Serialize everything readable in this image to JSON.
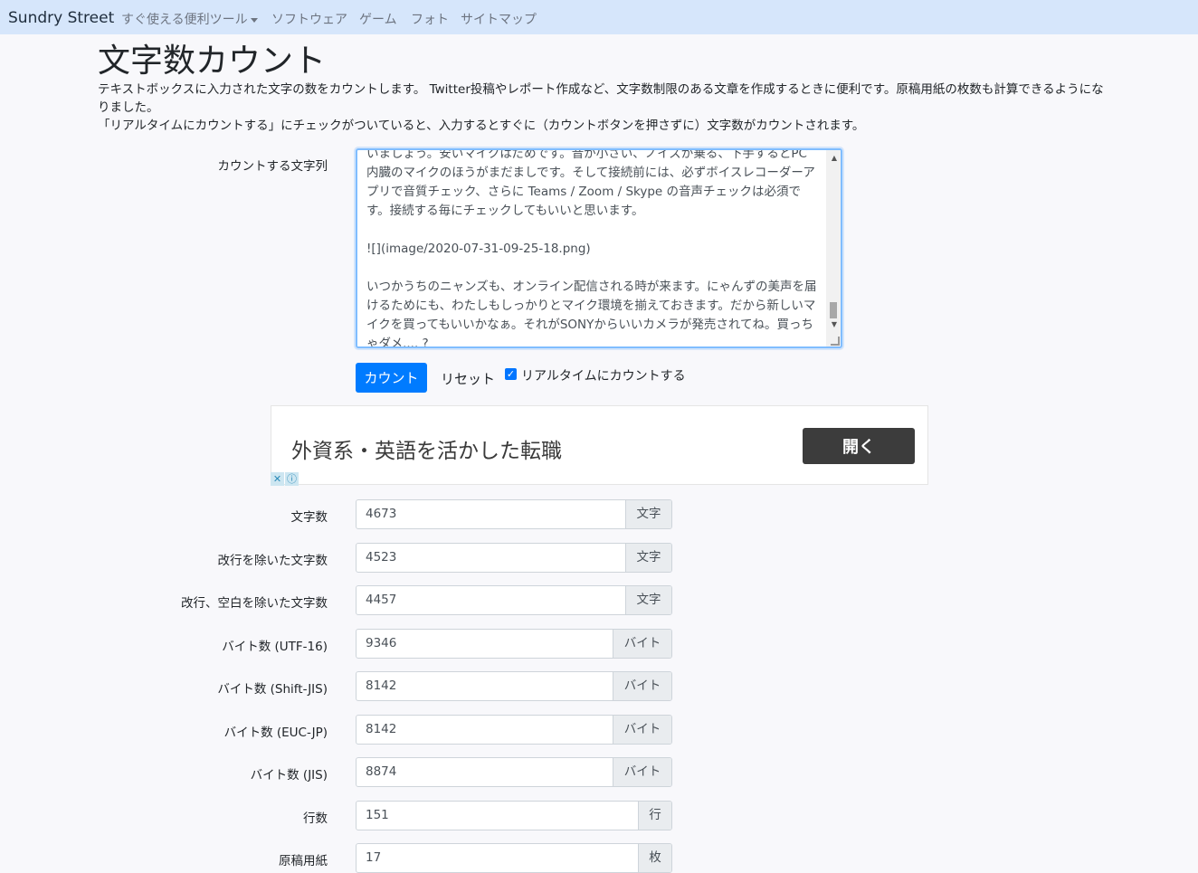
{
  "nav": {
    "brand": "Sundry Street",
    "items": [
      "すぐ使える便利ツール",
      "ソフトウェア",
      "ゲーム",
      "フォト",
      "サイトマップ"
    ]
  },
  "page": {
    "title": "文字数カウント",
    "desc1": "テキストボックスに入力された文字の数をカウントします。 Twitter投稿やレポート作成など、文字数制限のある文章を作成するときに便利です。原稿用紙の枚数も計算できるようになりました。",
    "desc2": "「リアルタイムにカウントする」にチェックがついていると、入力するとすぐに（カウントボタンを押さずに）文字数がカウントされます。"
  },
  "form": {
    "input_label": "カウントする文字列",
    "textarea_value": "いましょう。安いマイクはだめです。音が小さい、ノイズが乗る、下手するとPC内臓のマイクのほうがまだましです。そして接続前には、必ずボイスレコーダーアプリで音質チェック、さらに Teams / Zoom / Skype の音声チェックは必須です。接続する毎にチェックしてもいいと思います。\n\n![](image/2020-07-31-09-25-18.png)\n\nいつかうちのニャンズも、オンライン配信される時が来ます。にゃんずの美声を届けるためにも、わたしもしっかりとマイク環境を揃えておきます。だから新しいマイクを買ってもいいかなぁ。それがSONYからいいカメラが発売されてね。買っちゃダメ.... ?",
    "count_button": "カウント",
    "reset_button": "リセット",
    "realtime_label": "リアルタイムにカウントする",
    "realtime_checked": true
  },
  "ad": {
    "text": "外資系・英語を活かした転職",
    "button": "開く"
  },
  "results": [
    {
      "label": "文字数",
      "value": "4673",
      "unit": "文字"
    },
    {
      "label": "改行を除いた文字数",
      "value": "4523",
      "unit": "文字"
    },
    {
      "label": "改行、空白を除いた文字数",
      "value": "4457",
      "unit": "文字"
    },
    {
      "label": "バイト数 (UTF-16)",
      "value": "9346",
      "unit": "バイト"
    },
    {
      "label": "バイト数 (Shift-JIS)",
      "value": "8142",
      "unit": "バイト"
    },
    {
      "label": "バイト数 (EUC-JP)",
      "value": "8142",
      "unit": "バイト"
    },
    {
      "label": "バイト数 (JIS)",
      "value": "8874",
      "unit": "バイト"
    },
    {
      "label": "行数",
      "value": "151",
      "unit": "行"
    },
    {
      "label": "原稿用紙",
      "value": "17",
      "unit": "枚"
    }
  ]
}
